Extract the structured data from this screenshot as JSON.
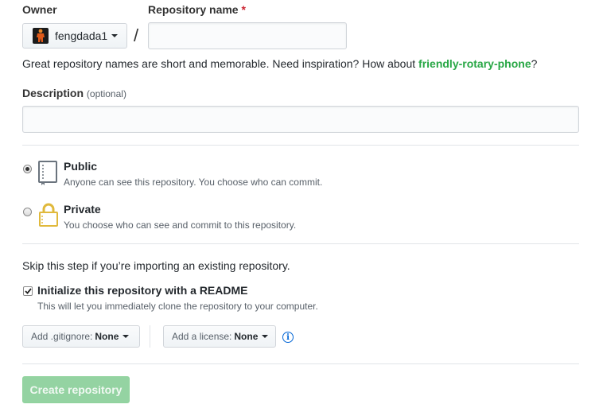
{
  "owner": {
    "label": "Owner",
    "selected": "fengdada1"
  },
  "repo_name": {
    "label": "Repository name",
    "required_mark": "*",
    "value": ""
  },
  "separator": "/",
  "hint": {
    "text": "Great repository names are short and memorable. Need inspiration? How about ",
    "suggestion": "friendly-rotary-phone",
    "end": "?"
  },
  "description": {
    "label": "Description",
    "optional": "(optional)",
    "value": ""
  },
  "visibility": {
    "selected": "public",
    "options": [
      {
        "title": "Public",
        "note": "Anyone can see this repository. You choose who can commit.",
        "icon": "repo-book-icon"
      },
      {
        "title": "Private",
        "note": "You choose who can see and commit to this repository.",
        "icon": "lock-icon"
      }
    ]
  },
  "import_hint": "Skip this step if you’re importing an existing repository.",
  "readme": {
    "checked": true,
    "label": "Initialize this repository with a README",
    "note": "This will let you immediately clone the repository to your computer."
  },
  "gitignore": {
    "label": "Add .gitignore:",
    "value": "None"
  },
  "license": {
    "label": "Add a license:",
    "value": "None"
  },
  "info_icon": "info-icon",
  "create_button": "Create repository",
  "colors": {
    "suggestion": "#28a745",
    "required": "#cb2431",
    "create_button_bg": "#94d3a2",
    "info": "#0366d6"
  }
}
